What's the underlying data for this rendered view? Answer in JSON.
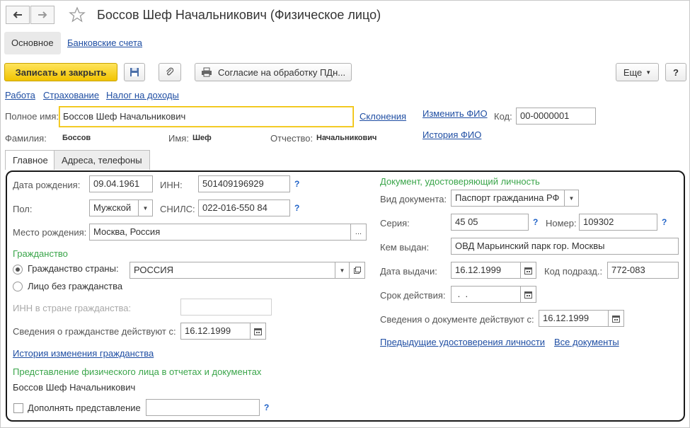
{
  "window": {
    "title": "Боссов Шеф Начальникович (Физическое лицо)"
  },
  "nav": {
    "tab_main": "Основное",
    "tab_bank": "Банковские счета"
  },
  "toolbar": {
    "save_close": "Записать и закрыть",
    "consent": "Согласие на обработку ПДн...",
    "more": "Еще",
    "help": "?"
  },
  "top_links": {
    "work": "Работа",
    "insurance": "Страхование",
    "tax": "Налог на доходы"
  },
  "header": {
    "fullname_label": "Полное имя:",
    "fullname_value": "Боссов Шеф Начальникович",
    "declensions": "Склонения",
    "change_fio": "Изменить ФИО",
    "history_fio": "История ФИО",
    "code_label": "Код:",
    "code_value": "00-0000001",
    "surname_label": "Фамилия:",
    "surname_value": "Боссов",
    "name_label": "Имя:",
    "name_value": "Шеф",
    "patronymic_label": "Отчество:",
    "patronymic_value": "Начальникович"
  },
  "tabs": {
    "main": "Главное",
    "addresses": "Адреса, телефоны"
  },
  "left": {
    "birth_label": "Дата рождения:",
    "birth_value": "09.04.1961",
    "inn_label": "ИНН:",
    "inn_value": "501409196929",
    "gender_label": "Пол:",
    "gender_value": "Мужской",
    "snils_label": "СНИЛС:",
    "snils_value": "022-016-550 84",
    "birthplace_label": "Место рождения:",
    "birthplace_value": "Москва, Россия",
    "birthplace_btn": "...",
    "citizenship_title": "Гражданство",
    "country_radio": "Гражданство страны:",
    "country_value": "РОССИЯ",
    "stateless_radio": "Лицо без гражданства",
    "inn_country_label": "ИНН в стране гражданства:",
    "citizenship_since_label": "Сведения о гражданстве действуют с:",
    "citizenship_since_value": "16.12.1999",
    "citizenship_history": "История изменения гражданства",
    "representation_title": "Представление физического лица в отчетах и документах",
    "representation_value": "Боссов Шеф Начальникович",
    "supplement_label": "Дополнять представление",
    "qmark": "?"
  },
  "right": {
    "doc_title": "Документ, удостоверяющий личность",
    "doc_type_label": "Вид документа:",
    "doc_type_value": "Паспорт гражданина РФ",
    "series_label": "Серия:",
    "series_value": "45 05",
    "number_label": "Номер:",
    "number_value": "109302",
    "issued_by_label": "Кем выдан:",
    "issued_by_value": "ОВД Марьинский парк гор. Москвы",
    "issue_date_label": "Дата выдачи:",
    "issue_date_value": "16.12.1999",
    "dept_code_label": "Код подразд.:",
    "dept_code_value": "772-083",
    "valid_label": "Срок действия:",
    "valid_value": " .  .",
    "doc_since_label": "Сведения о документе действуют с:",
    "doc_since_value": "16.12.1999",
    "prev_docs": "Предыдущие удостоверения личности",
    "all_docs": "Все документы",
    "qmark": "?"
  }
}
